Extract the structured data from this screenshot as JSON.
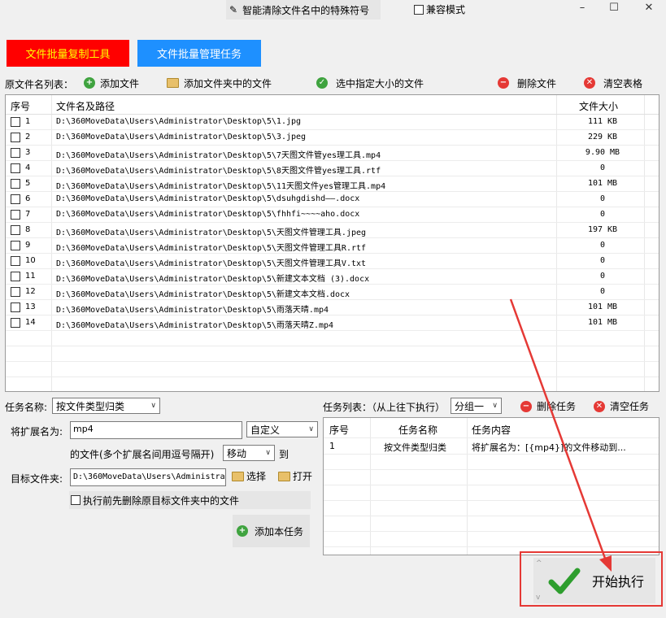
{
  "window": {
    "title": "智能清除文件名中的特殊符号",
    "compat_label": "兼容模式",
    "minimize": "–",
    "maximize": "☐",
    "close": "✕"
  },
  "top_buttons": {
    "copy_tool": "文件批量复制工具",
    "manage_task": "文件批量管理任务"
  },
  "toolbar": {
    "list_label": "原文件名列表：",
    "add_file": "添加文件",
    "add_folder": "添加文件夹中的文件",
    "select_size": "选中指定大小的文件",
    "delete_file": "删除文件",
    "clear_table": "清空表格"
  },
  "file_table": {
    "headers": {
      "no": "序号",
      "path": "文件名及路径",
      "size": "文件大小"
    },
    "rows": [
      {
        "no": "1",
        "path": "D:\\360MoveData\\Users\\Administrator\\Desktop\\5\\1.jpg",
        "size": "111 KB"
      },
      {
        "no": "2",
        "path": "D:\\360MoveData\\Users\\Administrator\\Desktop\\5\\3.jpeg",
        "size": "229 KB"
      },
      {
        "no": "3",
        "path": "D:\\360MoveData\\Users\\Administrator\\Desktop\\5\\7天图文件管yes理工具.mp4",
        "size": "9.90 MB"
      },
      {
        "no": "4",
        "path": "D:\\360MoveData\\Users\\Administrator\\Desktop\\5\\8天图文件管yes理工具.rtf",
        "size": "0"
      },
      {
        "no": "5",
        "path": "D:\\360MoveData\\Users\\Administrator\\Desktop\\5\\11天图文件yes管理工具.mp4",
        "size": "101 MB"
      },
      {
        "no": "6",
        "path": "D:\\360MoveData\\Users\\Administrator\\Desktop\\5\\dsuhgdishd——.docx",
        "size": "0"
      },
      {
        "no": "7",
        "path": "D:\\360MoveData\\Users\\Administrator\\Desktop\\5\\fhhfi~~~~aho.docx",
        "size": "0"
      },
      {
        "no": "8",
        "path": "D:\\360MoveData\\Users\\Administrator\\Desktop\\5\\天图文件管理工具.jpeg",
        "size": "197 KB"
      },
      {
        "no": "9",
        "path": "D:\\360MoveData\\Users\\Administrator\\Desktop\\5\\天图文件管理工具R.rtf",
        "size": "0"
      },
      {
        "no": "10",
        "path": "D:\\360MoveData\\Users\\Administrator\\Desktop\\5\\天图文件管理工具V.txt",
        "size": "0"
      },
      {
        "no": "11",
        "path": "D:\\360MoveData\\Users\\Administrator\\Desktop\\5\\新建文本文档 (3).docx",
        "size": "0"
      },
      {
        "no": "12",
        "path": "D:\\360MoveData\\Users\\Administrator\\Desktop\\5\\新建文本文档.docx",
        "size": "0"
      },
      {
        "no": "13",
        "path": "D:\\360MoveData\\Users\\Administrator\\Desktop\\5\\雨落天晴.mp4",
        "size": "101 MB"
      },
      {
        "no": "14",
        "path": "D:\\360MoveData\\Users\\Administrator\\Desktop\\5\\雨落天晴Z.mp4",
        "size": "101 MB"
      }
    ]
  },
  "task_form": {
    "name_label": "任务名称:",
    "name_value": "按文件类型归类",
    "ext_label": "将扩展名为:",
    "ext_value": "mp4",
    "mode_value": "自定义",
    "files_label": "的文件(多个扩展名间用逗号隔开)",
    "action_value": "移动",
    "to_label": "到",
    "target_label": "目标文件夹:",
    "target_value": "D:\\360MoveData\\Users\\Administrat",
    "choose_label": "选择",
    "open_label": "打开",
    "pre_delete_label": "执行前先删除原目标文件夹中的文件",
    "add_task_label": "添加本任务"
  },
  "task_list": {
    "label": "任务列表：（从上往下执行）",
    "group_value": "分组一",
    "delete_task": "删除任务",
    "clear_task": "清空任务",
    "headers": {
      "no": "序号",
      "name": "任务名称",
      "content": "任务内容"
    },
    "rows": [
      {
        "no": "1",
        "name": "按文件类型归类",
        "content": "将扩展名为：[{mp4}]的文件移动到..."
      }
    ]
  },
  "start": {
    "label": "开始执行"
  }
}
